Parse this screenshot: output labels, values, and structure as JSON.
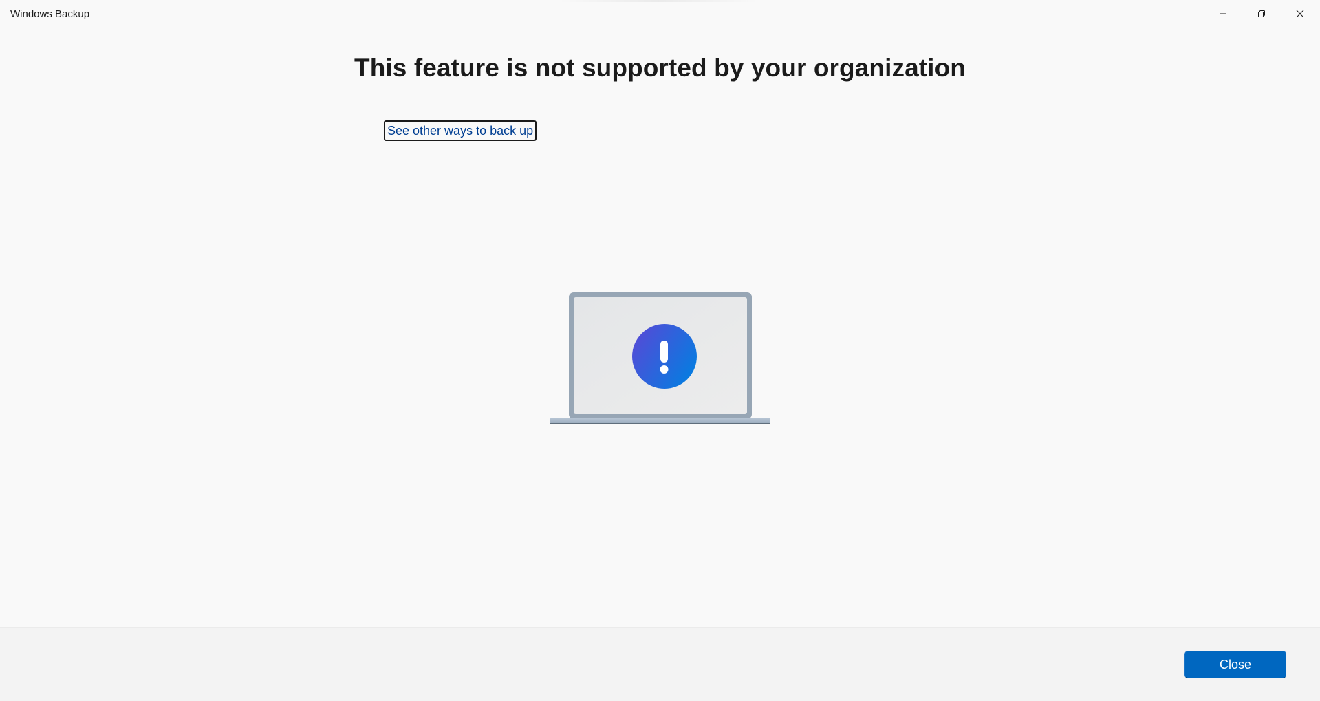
{
  "window": {
    "title": "Windows Backup",
    "controls": {
      "minimize_icon": "minimize-icon",
      "restore_icon": "restore-icon",
      "close_icon": "close-icon"
    }
  },
  "main": {
    "heading": "This feature is not supported by your organization",
    "link_text": "See other ways to back up",
    "illustration_icon": "laptop-alert-icon"
  },
  "footer": {
    "close_label": "Close"
  },
  "colors": {
    "accent": "#0067c0",
    "link": "#003e92",
    "background": "#f9f9f9",
    "footer_background": "#f3f3f3",
    "alert_gradient_start": "#5b46d6",
    "alert_gradient_end": "#0a7ae0"
  }
}
